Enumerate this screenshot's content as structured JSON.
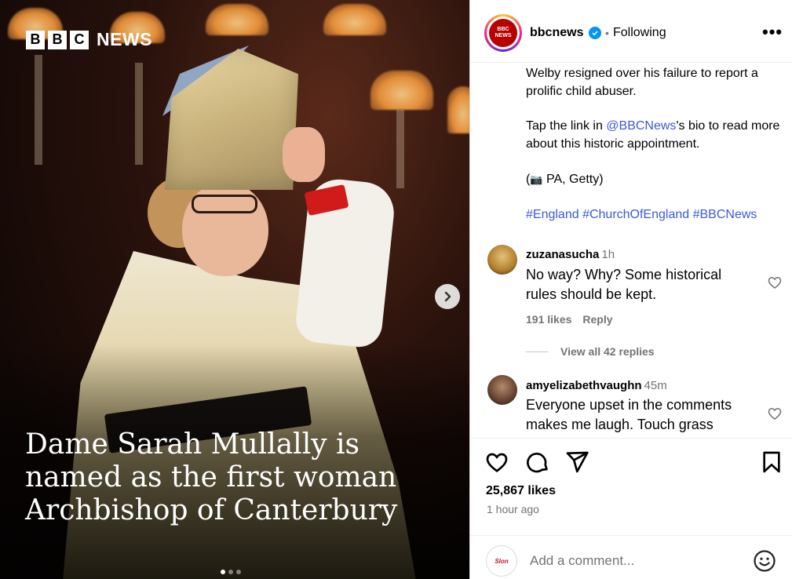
{
  "media": {
    "brand_box_1": "B",
    "brand_box_2": "B",
    "brand_box_3": "C",
    "brand_word": "NEWS",
    "headline": "Dame Sarah Mullally is named as the first woman Archbishop of Canterbury",
    "carousel_dots": 3,
    "active_dot": 0,
    "next_icon": "chevron-right-icon"
  },
  "header": {
    "avatar_text_1": "BBC",
    "avatar_text_2": "NEWS",
    "username": "bbcnews",
    "verified_icon": "check",
    "separator": "•",
    "following": "Following",
    "more": "•••"
  },
  "caption": {
    "line1": "Welby resigned over his failure to report a prolific child abuser.",
    "line2_pre": "Tap the link in ",
    "line2_link": "@BBCNews",
    "line2_post": "'s bio to read more about this historic appointment.",
    "credit_open": "(",
    "credit_icon": "📷",
    "credit_text": " PA, Getty)",
    "hashtags": "#England #ChurchOfEngland #BBCNews"
  },
  "comments": [
    {
      "user": "zuzanasucha",
      "time": "1h",
      "text": "No way? Why? Some historical rules should be kept.",
      "likes": "191 likes",
      "reply": "Reply",
      "view_replies": "View all 42 replies"
    },
    {
      "user": "amyelizabethvaughn",
      "time": "45m",
      "text": "Everyone upset in the comments makes me laugh. Touch grass"
    }
  ],
  "actions": {
    "like_icon": "heart-icon",
    "comment_icon": "comment-icon",
    "share_icon": "send-icon",
    "save_icon": "bookmark-icon"
  },
  "likes": "25,867 likes",
  "time_ago": "1 hour ago",
  "add_comment": {
    "avatar_text": "Slon",
    "placeholder": "Add a comment...",
    "emoji_icon": "emoji-icon"
  },
  "colors": {
    "link": "#3d5ad6",
    "verified": "#0095f6",
    "bbc_red": "#b80000",
    "secondary_text": "#737373"
  }
}
